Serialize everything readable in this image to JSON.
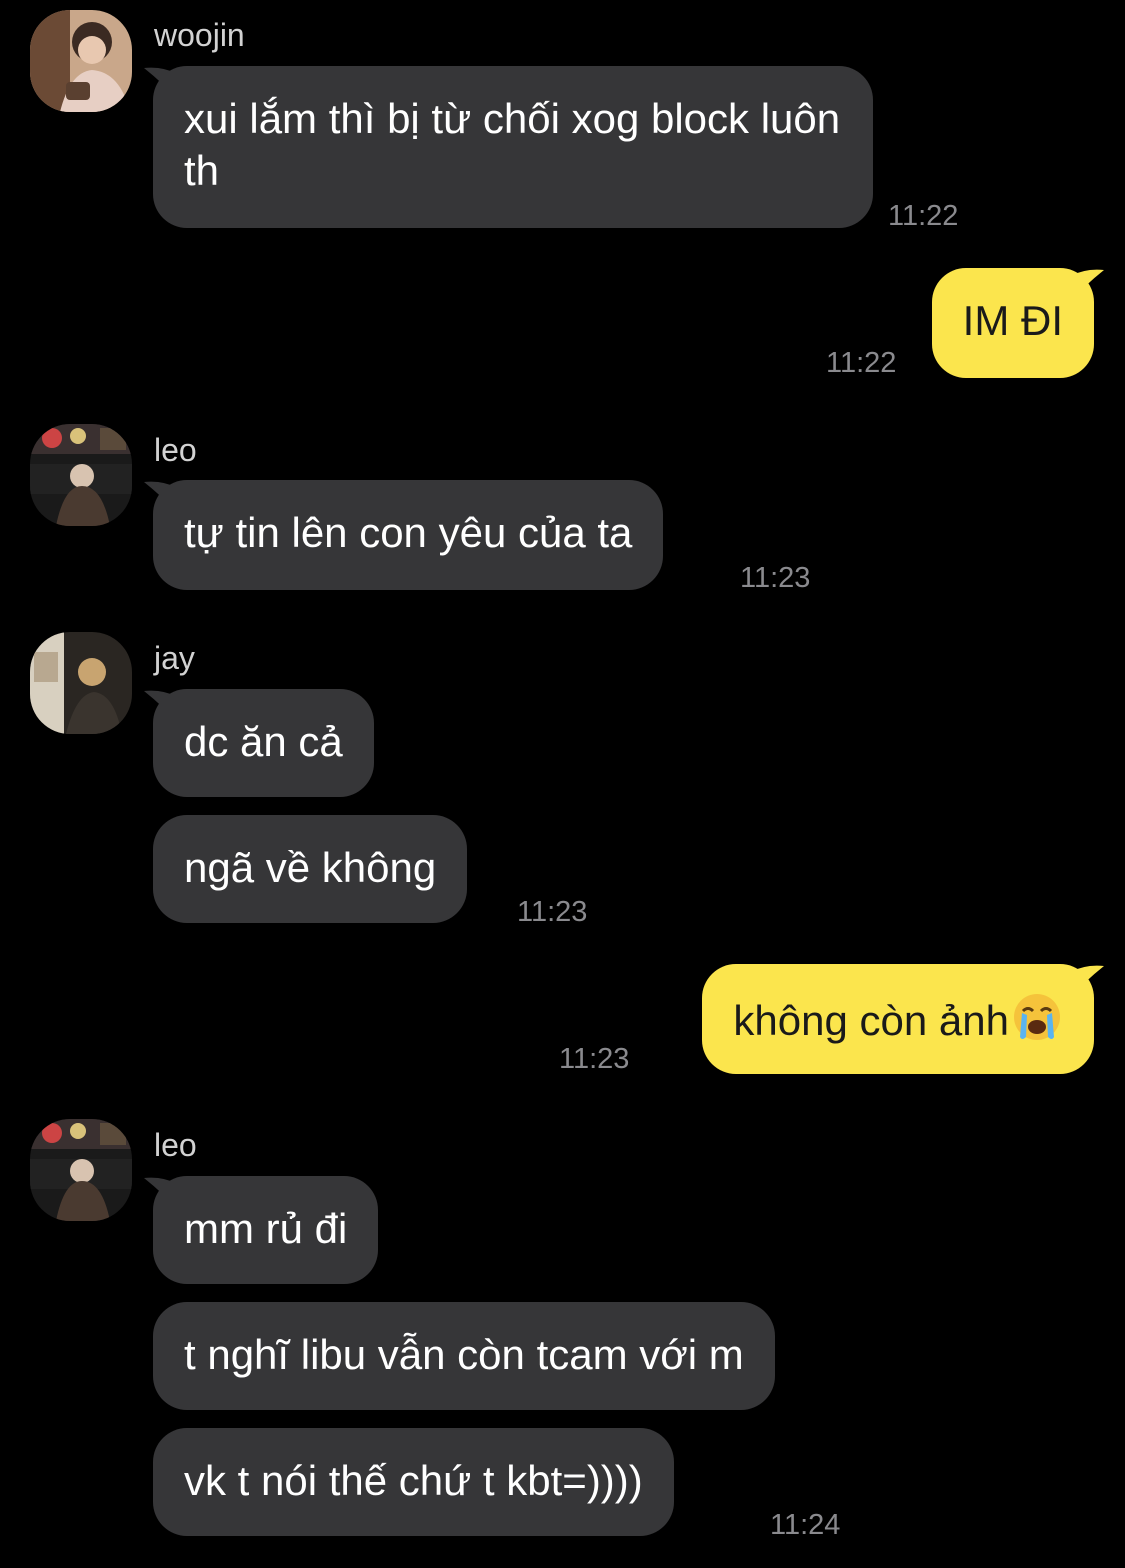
{
  "messages": {
    "m1": {
      "sender": "woojin",
      "text": "xui lắm thì bị từ chối xog block luôn th",
      "time": "11:22"
    },
    "m2": {
      "text": "IM ĐI",
      "time": "11:22"
    },
    "m3": {
      "sender": "leo",
      "text": "tự tin lên con yêu của ta",
      "time": "11:23"
    },
    "m4": {
      "sender": "jay",
      "text": "dc ăn cả"
    },
    "m5": {
      "text": "ngã về không",
      "time": "11:23"
    },
    "m6": {
      "text": "không còn ảnh",
      "emoji": "loudly-crying-face",
      "time": "11:23"
    },
    "m7": {
      "sender": "leo",
      "text": "mm rủ đi"
    },
    "m8": {
      "text": "t nghĩ libu vẫn còn tcam với m"
    },
    "m9": {
      "text": "vk t nói thế chứ t kbt=))))",
      "time": "11:24"
    }
  },
  "colors": {
    "background": "#000000",
    "incoming_bubble": "#363638",
    "outgoing_bubble": "#fbe54d",
    "timestamp": "#8a8a8e"
  }
}
